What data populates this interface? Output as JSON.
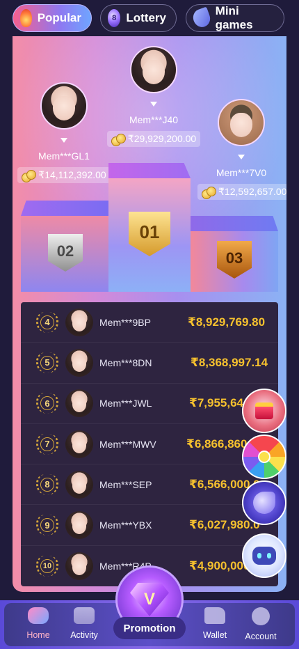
{
  "tabs": [
    {
      "label": "Popular",
      "icon": "fire-icon",
      "active": true
    },
    {
      "label": "Lottery",
      "icon": "lottery-ball-icon",
      "active": false
    },
    {
      "label": "Mini games",
      "icon": "rocket-icon",
      "active": false
    }
  ],
  "podium": {
    "first": {
      "rank_badge": "01",
      "name": "Mem***J40",
      "amount": "₹29,929,200.00"
    },
    "second": {
      "rank_badge": "02",
      "name": "Mem***GL1",
      "amount": "₹14,112,392.00"
    },
    "third": {
      "rank_badge": "03",
      "name": "Mem***7V0",
      "amount": "₹12,592,657.00"
    }
  },
  "ranking": [
    {
      "rank": "4",
      "name": "Mem***9BP",
      "amount": "₹8,929,769.80"
    },
    {
      "rank": "5",
      "name": "Mem***8DN",
      "amount": "₹8,368,997.14"
    },
    {
      "rank": "6",
      "name": "Mem***JWL",
      "amount": "₹7,955,64"
    },
    {
      "rank": "7",
      "name": "Mem***MWV",
      "amount": "₹6,866,860"
    },
    {
      "rank": "8",
      "name": "Mem***SEP",
      "amount": "₹6,566,000.0"
    },
    {
      "rank": "9",
      "name": "Mem***YBX",
      "amount": "₹6,027,980.0"
    },
    {
      "rank": "10",
      "name": "Mem***R4P",
      "amount": "₹4,900,000"
    }
  ],
  "promotion": {
    "label": "Promotion",
    "glyph": "V"
  },
  "nav": [
    {
      "label": "Home",
      "active": true
    },
    {
      "label": "Activity",
      "active": false
    },
    {
      "label": "Wallet",
      "active": false
    },
    {
      "label": "Account",
      "active": false
    }
  ],
  "colors": {
    "amount_gold": "#f6c12e",
    "active_tab_gradient_start": "#f65f8d",
    "active_tab_gradient_end": "#6fa5ff"
  }
}
